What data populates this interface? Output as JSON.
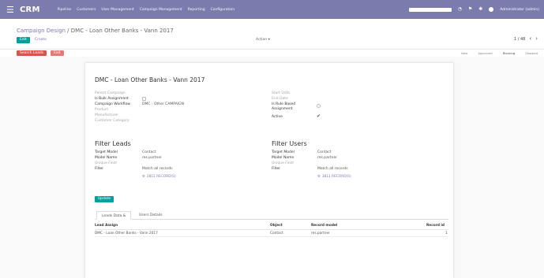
{
  "topbar": {
    "app_name": "CRM",
    "menu": [
      "Pipeline",
      "Customers",
      "User Management",
      "Campaign Management",
      "Reporting",
      "Configuration"
    ],
    "user": "Administrator (admin)",
    "icons": [
      "apps-menu-icon",
      "chat-icon",
      "activity-icon",
      "user-avatar"
    ]
  },
  "breadcrumb": {
    "parent": "Campaign Design",
    "separator": " / ",
    "current": "DMC - Loan Other Banks - Vann 2017"
  },
  "buttons": {
    "edit": "Edit",
    "create": "Create",
    "search_leads": "Search Leads",
    "exit": "Exit",
    "update": "Update"
  },
  "action_menu": "Action ▾",
  "pager": {
    "text": "1 / 48",
    "prev": "‹",
    "next": "›"
  },
  "stages": [
    {
      "label": "New",
      "active": false
    },
    {
      "label": "Approved",
      "active": false
    },
    {
      "label": "Running",
      "active": true
    },
    {
      "label": "Stopped",
      "active": false
    }
  ],
  "form": {
    "title": "DMC - Loan Other Banks - Vann 2017",
    "left_fields": [
      {
        "label": "Parent Campaign",
        "value": "",
        "muted": true
      },
      {
        "label": "Is Bulk Assignment",
        "value": "",
        "muted": false
      },
      {
        "label": "Campaign Workflow",
        "value": "DMC - Other CAMPAIGN",
        "muted": false
      },
      {
        "label": "Product",
        "value": "",
        "muted": true
      },
      {
        "label": "Manufacturer",
        "value": "",
        "muted": true
      },
      {
        "label": "Customer Category",
        "value": "",
        "muted": true
      }
    ],
    "right_fields": [
      {
        "label": "Start Date",
        "muted": true
      },
      {
        "label": "End Date",
        "muted": true
      },
      {
        "label": "Is Rule Based",
        "muted": false
      },
      {
        "label": "Assignment",
        "muted": false
      },
      {
        "label": "Active",
        "muted": false
      }
    ],
    "filter_leads": {
      "title": "Filter Leads",
      "target_model_label": "Target Model",
      "target_model_value": "Contact",
      "model_name_label": "Model Name",
      "model_name_value": "res.partner",
      "unique_field_label": "Unique Field",
      "filter_label": "Filter",
      "filter_value": "Match all records",
      "records_link": "2811 RECORD(S)"
    },
    "filter_users": {
      "title": "Filter Users",
      "target_model_label": "Target Model",
      "target_model_value": "Contact",
      "model_name_label": "Model Name",
      "model_name_value": "res.partner",
      "unique_field_label": "Unique Field",
      "filter_label": "Filter",
      "filter_value": "Match all records",
      "records_link": "3811 RECORD(S)"
    }
  },
  "tabs": [
    "Leads Data &",
    "Users Details"
  ],
  "table": {
    "columns": [
      "Lead Assign",
      "Object",
      "Record model",
      "Record id"
    ],
    "rows": [
      {
        "lead": "DMC - Loan Other Banks - Vann 2017",
        "object": "Contact",
        "model": "res.partner",
        "id": "1"
      }
    ]
  },
  "colors": {
    "topbar": "#7c7bad",
    "primary": "#00a09d",
    "danger": "#d9534f"
  }
}
